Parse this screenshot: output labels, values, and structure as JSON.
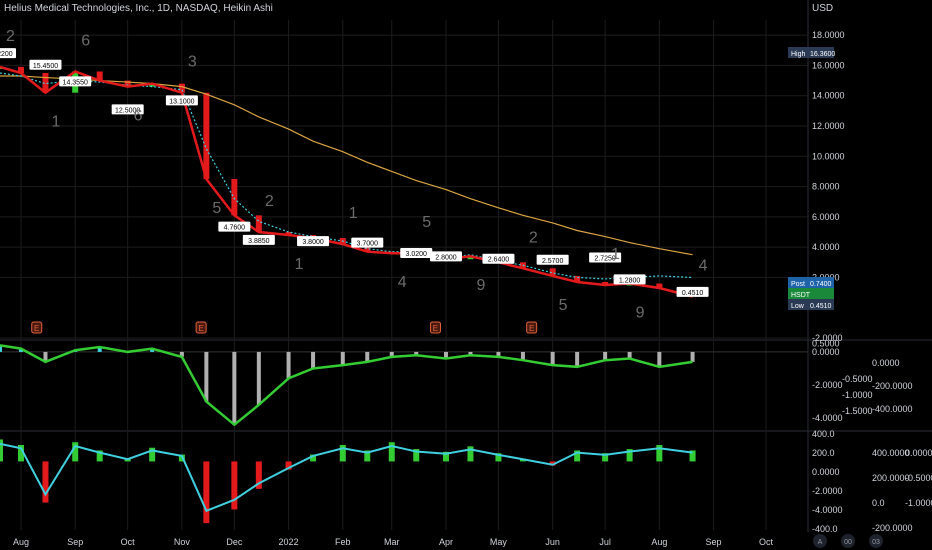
{
  "header": {
    "title": "Helius Medical Technologies, Inc., 1D, NASDAQ, Heikin Ashi",
    "currency": "USD"
  },
  "badges": {
    "high_label": "High",
    "high_value": "16.3600",
    "post_label": "Post",
    "post_value": "0.7400",
    "hsdt_label": "HSDT",
    "low_label": "Low",
    "low_value": "0.4510"
  },
  "colors": {
    "background": "#000000",
    "price_band": "#e31a1c",
    "ma_long": "#d9a441",
    "ma_cyan": "#3fd0e0",
    "bull": "#33cc33",
    "bear": "#e31a1c",
    "grid": "#1c1c1c"
  },
  "chart_data": [
    {
      "type": "line",
      "panel": "price",
      "y_ticks": [
        "18.0000",
        "16.0000",
        "14.0000",
        "12.0000",
        "10.0000",
        "8.0000",
        "6.0000",
        "4.0000",
        "2.0000",
        "-2.0000"
      ],
      "ylim": [
        -2,
        19
      ],
      "x": [
        "2021-07-20",
        "2021-08-01",
        "2021-08-15",
        "2021-09-01",
        "2021-09-15",
        "2021-10-01",
        "2021-10-15",
        "2021-11-01",
        "2021-11-15",
        "2021-12-01",
        "2021-12-15",
        "2022-01-01",
        "2022-01-15",
        "2022-02-01",
        "2022-02-15",
        "2022-03-01",
        "2022-03-15",
        "2022-04-01",
        "2022-04-15",
        "2022-05-01",
        "2022-05-15",
        "2022-06-01",
        "2022-06-15",
        "2022-07-01",
        "2022-07-15",
        "2022-08-01",
        "2022-08-20"
      ],
      "series": [
        {
          "key": "price",
          "values": [
            15.9,
            15.5,
            14.2,
            15.6,
            15.0,
            14.6,
            14.8,
            14.2,
            8.5,
            6.1,
            5.0,
            4.8,
            4.6,
            4.2,
            3.7,
            3.6,
            3.6,
            3.2,
            3.4,
            3.0,
            2.6,
            2.1,
            1.7,
            1.5,
            1.6,
            1.3,
            0.74
          ]
        },
        {
          "key": "ma_long",
          "values": [
            15.3,
            15.3,
            15.2,
            15.1,
            15.0,
            14.9,
            14.8,
            14.6,
            14.1,
            13.4,
            12.6,
            11.8,
            11.0,
            10.3,
            9.6,
            9.0,
            8.4,
            7.8,
            7.2,
            6.6,
            6.1,
            5.6,
            5.1,
            4.7,
            4.3,
            3.9,
            3.5
          ]
        },
        {
          "key": "ma_cyan",
          "values": [
            15.5,
            15.3,
            14.8,
            15.0,
            14.9,
            14.7,
            14.6,
            14.4,
            10.5,
            7.2,
            5.7,
            5.0,
            4.7,
            4.4,
            3.9,
            3.7,
            3.7,
            3.3,
            3.5,
            3.1,
            2.8,
            2.3,
            2.0,
            1.9,
            2.0,
            2.1,
            2.0
          ]
        }
      ],
      "annotations": [
        "16.2200",
        "15.4500",
        "14.3550",
        "12.5000",
        "13.1000",
        "4.7600",
        "3.8850",
        "3.8000",
        "3.7000",
        "3.0200",
        "2.8000",
        "2.6400",
        "2.5700",
        "2.7250",
        "1.2800",
        "0.4510"
      ],
      "wave_labels": [
        "2",
        "1",
        "6",
        "6",
        "3",
        "5",
        "2",
        "1",
        "1",
        "4",
        "5",
        "9",
        "2",
        "5",
        "1",
        "9",
        "4"
      ],
      "earnings_marker": "E"
    },
    {
      "type": "bar",
      "panel": "oscillator",
      "left_ticks": [
        "0.5000",
        "0.0000",
        "-2.0000",
        "-4.0000"
      ],
      "mid_ticks": [
        "-0.5000",
        "-1.0000",
        "-1.5000"
      ],
      "right_ticks": [
        "0.0000",
        "-200.0000",
        "-400.0000"
      ],
      "osc": [
        0.4,
        0.2,
        -0.6,
        0.1,
        0.3,
        0.0,
        0.2,
        -0.3,
        -3.0,
        -4.4,
        -3.2,
        -1.6,
        -1.0,
        -0.8,
        -0.6,
        -0.3,
        -0.2,
        -0.4,
        -0.2,
        -0.3,
        -0.5,
        -0.8,
        -0.9,
        -0.5,
        -0.4,
        -0.9,
        -0.6
      ]
    },
    {
      "type": "bar",
      "panel": "momentum",
      "left_ticks": [
        "400.0",
        "200.0",
        "0.0000",
        "-2.0000",
        "-4.0000",
        "-400.0"
      ],
      "mid_ticks": [
        "400.0000",
        "200.0000",
        "0.0",
        "-200.0000"
      ],
      "right_ticks": [
        "0.0000",
        "-0.5000",
        "-1.0000"
      ],
      "mom": [
        1.6,
        1.2,
        -3.0,
        1.4,
        0.8,
        0.2,
        1.0,
        0.5,
        -4.5,
        -3.5,
        -2.0,
        -0.6,
        0.5,
        1.2,
        0.8,
        1.4,
        0.9,
        0.7,
        1.1,
        0.6,
        0.2,
        -0.3,
        0.8,
        0.6,
        0.9,
        1.2,
        0.8
      ]
    }
  ],
  "x_axis": {
    "labels": [
      "Aug",
      "Sep",
      "Oct",
      "Nov",
      "Dec",
      "2022",
      "Feb",
      "Mar",
      "Apr",
      "May",
      "Jun",
      "Jul",
      "Aug",
      "Sep",
      "Oct"
    ],
    "corner": [
      "A",
      "00",
      "03"
    ]
  }
}
